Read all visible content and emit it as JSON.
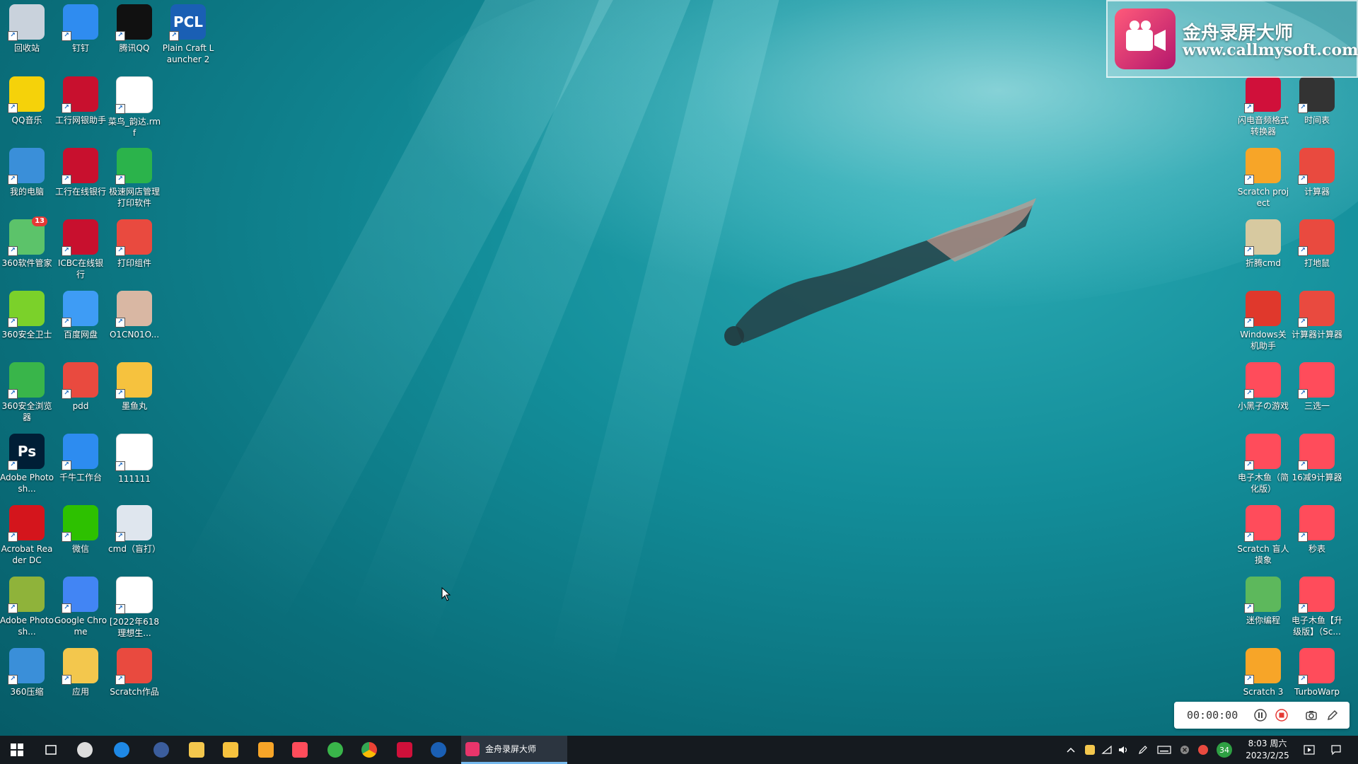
{
  "desktop": {
    "left_icons": [
      {
        "label": "回收站",
        "icon": "recycle-bin-icon",
        "color": "#c9d2dc"
      },
      {
        "label": "钉钉",
        "icon": "dingtalk-icon",
        "color": "#2f8cf0"
      },
      {
        "label": "腾讯QQ",
        "icon": "qq-penguin-icon",
        "color": "#111111"
      },
      {
        "label": "Plain Craft Launcher 2",
        "icon": "pcl-icon",
        "color": "#1a5fb4",
        "text": "PCL"
      },
      {
        "label": "QQ音乐",
        "icon": "qq-music-icon",
        "color": "#f5d20a"
      },
      {
        "label": "工行网银助手",
        "icon": "icbc-icon",
        "color": "#c8102e"
      },
      {
        "label": "菜鸟_韵达.rmf",
        "icon": "document-icon",
        "color": "#ffffff"
      },
      {
        "label": "我的电脑",
        "icon": "computer-icon",
        "color": "#3a8fd9"
      },
      {
        "label": "工行在线银行",
        "icon": "icbc-icon",
        "color": "#c8102e"
      },
      {
        "label": "极速网店管理打印软件",
        "icon": "printer-app-icon",
        "color": "#2bb34b"
      },
      {
        "label": "360软件管家",
        "icon": "software-manager-icon",
        "color": "#5cc36a",
        "badge": "13"
      },
      {
        "label": "ICBC在线银行",
        "icon": "icbc-icon",
        "color": "#c8102e"
      },
      {
        "label": "打印组件",
        "icon": "archive-icon",
        "color": "#e94a3f"
      },
      {
        "label": "360安全卫士",
        "icon": "360-safe-icon",
        "color": "#7bd12a"
      },
      {
        "label": "百度网盘",
        "icon": "baidu-netdisk-icon",
        "color": "#3e9cf5"
      },
      {
        "label": "O1CN01O...",
        "icon": "image-file-icon",
        "color": "#d9b7a3"
      },
      {
        "label": "360安全浏览器",
        "icon": "360-browser-icon",
        "color": "#39b54a"
      },
      {
        "label": "pdd",
        "icon": "archive-icon",
        "color": "#e94a3f"
      },
      {
        "label": "墨鱼丸",
        "icon": "mascot-app-icon",
        "color": "#f6c23e"
      },
      {
        "label": "Adobe Photosh...",
        "icon": "photoshop-icon",
        "color": "#001e36",
        "text": "Ps"
      },
      {
        "label": "千牛工作台",
        "icon": "qianniu-icon",
        "color": "#2d8cf0"
      },
      {
        "label": "111111",
        "icon": "blank-file-icon",
        "color": "#ffffff"
      },
      {
        "label": "Acrobat Reader DC",
        "icon": "acrobat-icon",
        "color": "#d4151c"
      },
      {
        "label": "微信",
        "icon": "wechat-icon",
        "color": "#2dc100"
      },
      {
        "label": "cmd（盲打）",
        "icon": "cmd-screen-icon",
        "color": "#dfe6ee"
      },
      {
        "label": "Adobe Photosh...",
        "icon": "photoshop-feather-icon",
        "color": "#8fb33a"
      },
      {
        "label": "Google Chrome",
        "icon": "chrome-icon",
        "color": "#4285f4"
      },
      {
        "label": "[2022年618理想生...",
        "icon": "spreadsheet-icon",
        "color": "#ffffff"
      },
      {
        "label": "360压缩",
        "icon": "360-zip-icon",
        "color": "#3a8fd9"
      },
      {
        "label": "应用",
        "icon": "folder-icon",
        "color": "#f3c74d"
      },
      {
        "label": "Scratch作品",
        "icon": "archive-icon",
        "color": "#e94a3f"
      }
    ],
    "right_icons": [
      {
        "label": "闪电音频格式转换器",
        "icon": "audio-converter-icon",
        "color": "#d0103a"
      },
      {
        "label": "时间表",
        "icon": "clock-icon",
        "color": "#333333"
      },
      {
        "label": "Scratch project",
        "icon": "scratch-icon",
        "color": "#f7a528"
      },
      {
        "label": "计算器",
        "icon": "archive-icon",
        "color": "#e94a3f"
      },
      {
        "label": "折腾cmd",
        "icon": "archive-icon",
        "color": "#d7c9a0"
      },
      {
        "label": "打地鼠",
        "icon": "archive-icon",
        "color": "#e94a3f"
      },
      {
        "label": "Windows关机助手",
        "icon": "power-icon",
        "color": "#e0382c"
      },
      {
        "label": "计算器计算器",
        "icon": "archive-icon",
        "color": "#e94a3f"
      },
      {
        "label": "小黑子の游戏",
        "icon": "turbowarp-icon",
        "color": "#ff4c5b"
      },
      {
        "label": "三选一",
        "icon": "turbowarp-icon",
        "color": "#ff4c5b"
      },
      {
        "label": "电子木鱼（简化版）",
        "icon": "turbowarp-icon",
        "color": "#ff4c5b"
      },
      {
        "label": "16减9计算器",
        "icon": "turbowarp-icon",
        "color": "#ff4c5b"
      },
      {
        "label": "Scratch 盲人摸象",
        "icon": "turbowarp-icon",
        "color": "#ff4c5b"
      },
      {
        "label": "秒表",
        "icon": "turbowarp-icon",
        "color": "#ff4c5b"
      },
      {
        "label": "迷你编程",
        "icon": "mini-coding-icon",
        "color": "#5db85c"
      },
      {
        "label": "电子木鱼【升级版】（Sc...",
        "icon": "turbowarp-icon",
        "color": "#ff4c5b"
      },
      {
        "label": "Scratch 3",
        "icon": "scratch-icon",
        "color": "#f7a528"
      },
      {
        "label": "TurboWarp",
        "icon": "turbowarp-icon",
        "color": "#ff4c5b"
      }
    ]
  },
  "watermark": {
    "title": "金舟录屏大师",
    "url": "www.callmysoft.com"
  },
  "recorder": {
    "time": "00:00:00"
  },
  "taskbar": {
    "active_app": "金舟录屏大师",
    "clock": {
      "time": "8:03 周六",
      "date": "2023/2/25"
    },
    "tray_badge": "34"
  }
}
